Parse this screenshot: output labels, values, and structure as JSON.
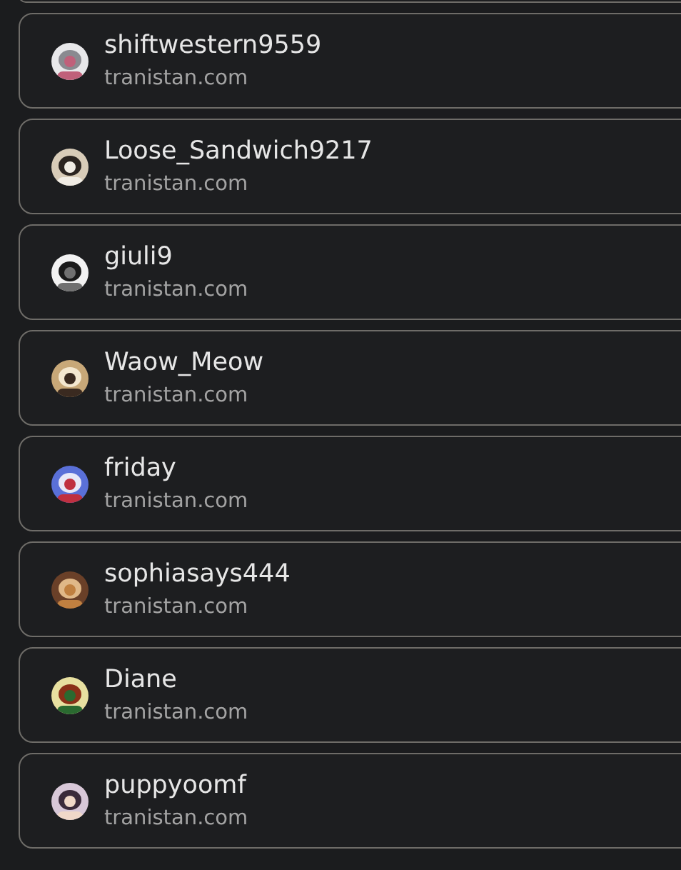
{
  "accounts": [
    {
      "name": "shiftwestern9559",
      "domain": "tranistan.com"
    },
    {
      "name": "Loose_Sandwich9217",
      "domain": "tranistan.com"
    },
    {
      "name": "giuli9",
      "domain": "tranistan.com"
    },
    {
      "name": "Waow_Meow",
      "domain": "tranistan.com"
    },
    {
      "name": "friday",
      "domain": "tranistan.com"
    },
    {
      "name": "sophiasays444",
      "domain": "tranistan.com"
    },
    {
      "name": "Diane",
      "domain": "tranistan.com"
    },
    {
      "name": "puppyoomf",
      "domain": "tranistan.com"
    }
  ]
}
